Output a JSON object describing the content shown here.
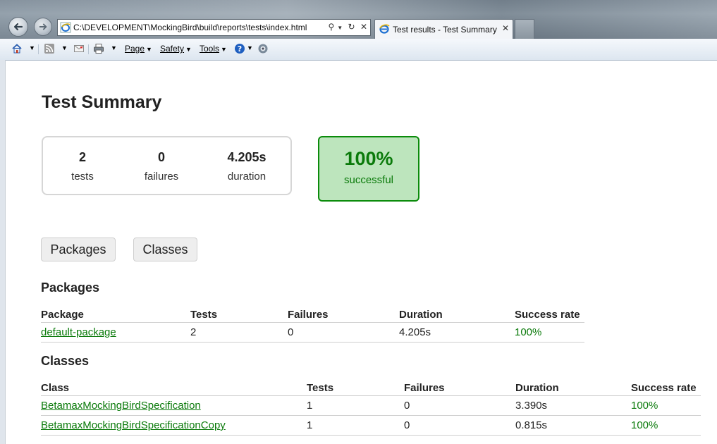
{
  "browser": {
    "address_url": "C:\\DEVELOPMENT\\MockingBird\\build\\reports\\tests\\index.html",
    "tab_title": "Test results - Test Summary",
    "menu": {
      "page": "Page",
      "safety": "Safety",
      "tools": "Tools"
    }
  },
  "report": {
    "title": "Test Summary",
    "counters": [
      {
        "value": "2",
        "label": "tests"
      },
      {
        "value": "0",
        "label": "failures"
      },
      {
        "value": "4.205s",
        "label": "duration"
      }
    ],
    "success": {
      "value": "100%",
      "label": "successful"
    },
    "tabs": [
      "Packages",
      "Classes"
    ],
    "packages": {
      "heading": "Packages",
      "columns": [
        "Package",
        "Tests",
        "Failures",
        "Duration",
        "Success rate"
      ],
      "rows": [
        {
          "name": "default-package",
          "tests": "2",
          "failures": "0",
          "duration": "4.205s",
          "success_rate": "100%"
        }
      ]
    },
    "classes": {
      "heading": "Classes",
      "columns": [
        "Class",
        "Tests",
        "Failures",
        "Duration",
        "Success rate"
      ],
      "rows": [
        {
          "name": "BetamaxMockingBirdSpecification",
          "tests": "1",
          "failures": "0",
          "duration": "3.390s",
          "success_rate": "100%"
        },
        {
          "name": "BetamaxMockingBirdSpecificationCopy",
          "tests": "1",
          "failures": "0",
          "duration": "0.815s",
          "success_rate": "100%"
        }
      ]
    }
  },
  "colors": {
    "success_green": "#0a7a0a",
    "success_bg": "#bde5bd",
    "link_green": "#0a7a0a"
  }
}
